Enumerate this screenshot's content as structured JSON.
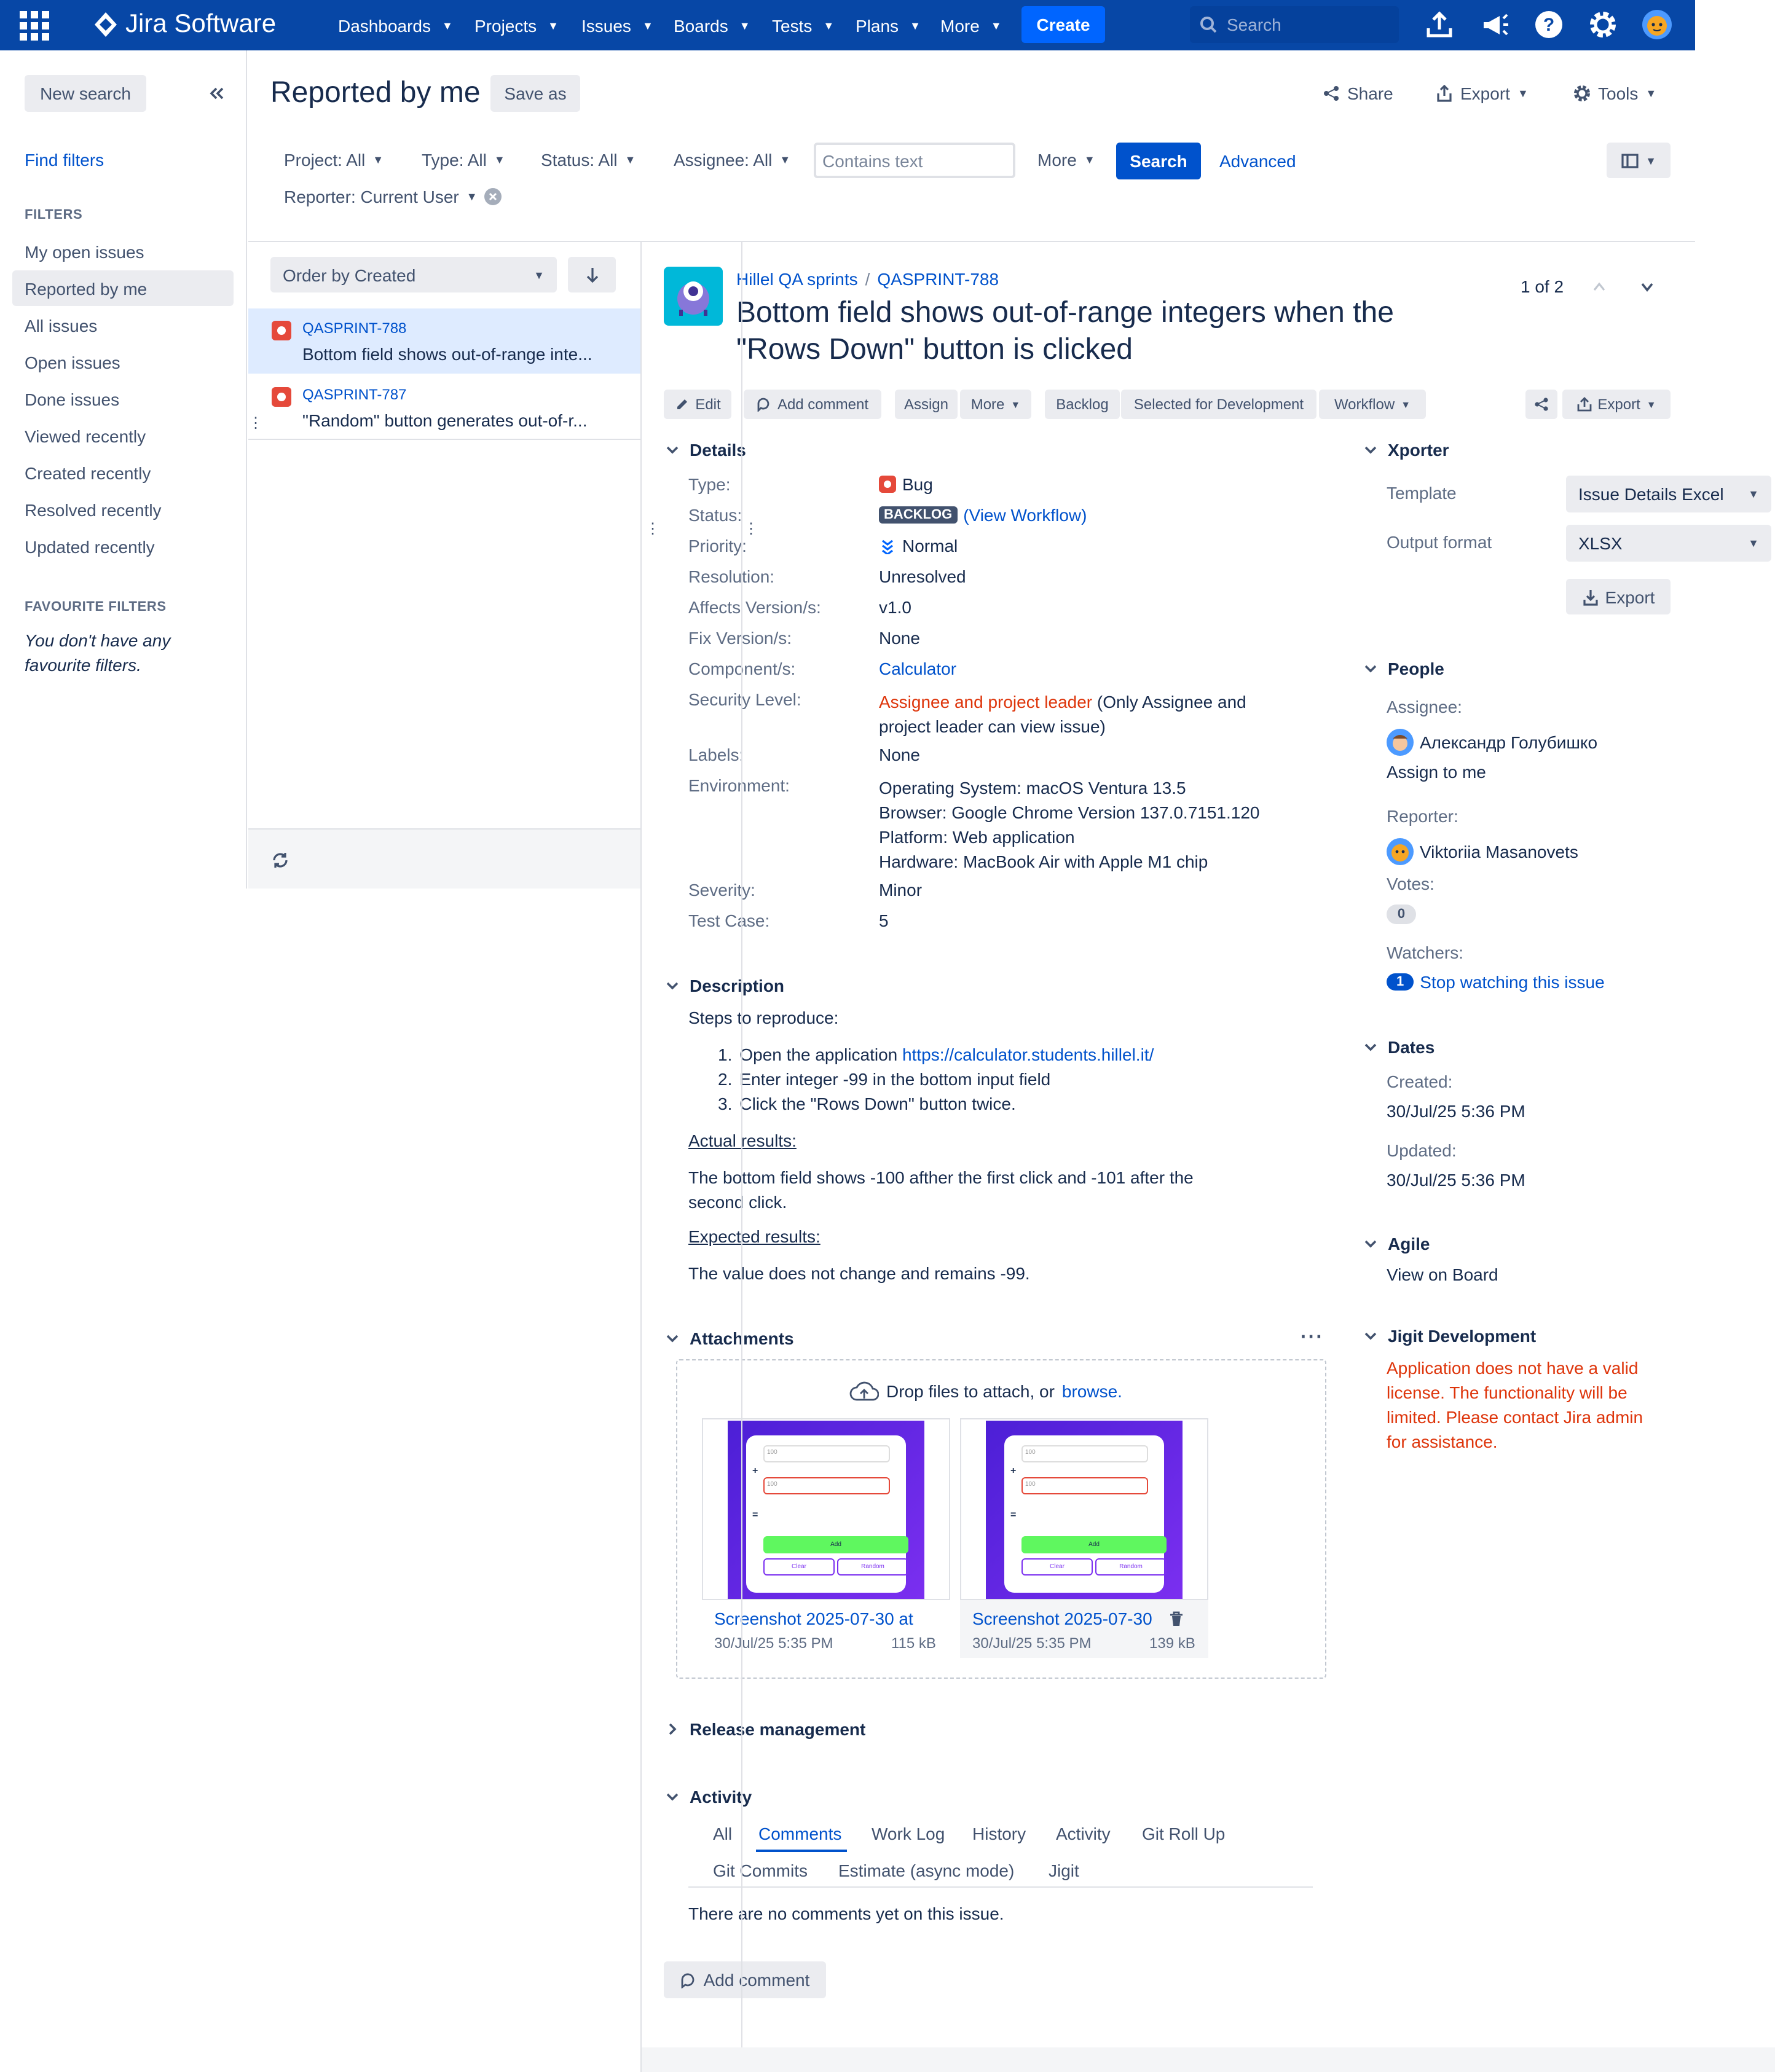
{
  "colors": {
    "nav": "#0747a6",
    "create": "#0065ff",
    "primary": "#0052cc",
    "selected_row": "#deebff",
    "bug": "#e5493a",
    "error": "#de350b"
  },
  "topnav": {
    "logo": "Jira Software",
    "items": [
      "Dashboards",
      "Projects",
      "Issues",
      "Boards",
      "Tests",
      "Plans",
      "More"
    ],
    "create": "Create",
    "search_placeholder": "Search",
    "icons": [
      "upload-icon",
      "megaphone-icon",
      "help-icon",
      "settings-icon",
      "user-avatar"
    ]
  },
  "sidebar": {
    "new_search": "New search",
    "find_filters": "Find filters",
    "filters_heading": "FILTERS",
    "filters": [
      "My open issues",
      "Reported by me",
      "All issues",
      "Open issues",
      "Done issues",
      "Viewed recently",
      "Created recently",
      "Resolved recently",
      "Updated recently"
    ],
    "selected": "Reported by me",
    "fav_heading": "FAVOURITE FILTERS",
    "fav_empty": "You don't have any favourite filters."
  },
  "header": {
    "title": "Reported by me",
    "save_as": "Save as",
    "share": "Share",
    "export": "Export",
    "tools": "Tools"
  },
  "search": {
    "project": "Project: All",
    "type": "Type: All",
    "status": "Status: All",
    "assignee": "Assignee: All",
    "text_placeholder": "Contains text",
    "more": "More",
    "search_btn": "Search",
    "advanced": "Advanced",
    "reporter": "Reporter: Current User"
  },
  "list": {
    "order": "Order by Created",
    "items": [
      {
        "key": "QASPRINT-788",
        "summary": "Bottom field shows out-of-range inte..."
      },
      {
        "key": "QASPRINT-787",
        "summary": "\"Random\" button generates out-of-r..."
      }
    ]
  },
  "issue": {
    "project": "Hillel QA sprints",
    "key": "QASPRINT-788",
    "counter": "1 of 2",
    "title_line1": "Bottom field shows out-of-range integers when the",
    "title_line2": "\"Rows Down\" button is clicked",
    "toolbar": {
      "edit": "Edit",
      "add_comment": "Add comment",
      "assign": "Assign",
      "more": "More",
      "backlog": "Backlog",
      "selected_for_dev": "Selected for Development",
      "workflow": "Workflow",
      "export": "Export"
    },
    "details_heading": "Details",
    "details": {
      "type_label": "Type:",
      "type": "Bug",
      "status_label": "Status:",
      "status": "BACKLOG",
      "view_workflow": "(View Workflow)",
      "priority_label": "Priority:",
      "priority": "Normal",
      "resolution_label": "Resolution:",
      "resolution": "Unresolved",
      "affects_label": "Affects Version/s:",
      "affects": "v1.0",
      "fix_label": "Fix Version/s:",
      "fix": "None",
      "component_label": "Component/s:",
      "component": "Calculator",
      "security_label": "Security Level:",
      "security_link": "Assignee and project leader",
      "security_rest1": " (Only Assignee and",
      "security_rest2": "project leader can view issue)",
      "labels_label": "Labels:",
      "labels": "None",
      "env_label": "Environment:",
      "env": [
        "Operating System: macOS Ventura 13.5",
        "Browser: Google Chrome Version 137.0.7151.120",
        "Platform: Web application",
        "Hardware: MacBook Air with Apple M1 chip"
      ],
      "severity_label": "Severity:",
      "severity": "Minor",
      "testcase_label": "Test Case:",
      "testcase": "5"
    },
    "description_heading": "Description",
    "description": {
      "steps_title": "Steps to reproduce:",
      "step1_prefix": "Open the application ",
      "step1_link": "https://calculator.students.hillel.it/",
      "step2": "Enter integer -99 in the bottom input field",
      "step3": "Click the \"Rows Down\" button twice.",
      "actual_title": "Actual results:",
      "actual1": "The bottom field shows -100 afther the first click and -101 after the",
      "actual2": "second click.",
      "expected_title": "Expected results:",
      "expected": "The value does not change and remains -99."
    },
    "attachments_heading": "Attachments",
    "drop_text": "Drop files to attach, or ",
    "browse": "browse.",
    "attachments": [
      {
        "name": "Screenshot 2025-07-30 at",
        "date": "30/Jul/25 5:35 PM",
        "size": "115 kB"
      },
      {
        "name": "Screenshot 2025-07-30",
        "date": "30/Jul/25 5:35 PM",
        "size": "139 kB"
      }
    ],
    "release_heading": "Release management",
    "activity_heading": "Activity",
    "activity_tabs": [
      "All",
      "Comments",
      "Work Log",
      "History",
      "Activity",
      "Git Roll Up",
      "Git Commits",
      "Estimate (async mode)",
      "Jigit"
    ],
    "active_tab": "Comments",
    "no_comments": "There are no comments yet on this issue.",
    "add_comment_btn": "Add comment"
  },
  "right": {
    "xporter_heading": "Xporter",
    "template_label": "Template",
    "template_value": "Issue Details Excel",
    "output_label": "Output format",
    "output_value": "XLSX",
    "export_btn": "Export",
    "people_heading": "People",
    "assignee_label": "Assignee:",
    "assignee": "Александр Голубишко",
    "assign_to_me": "Assign to me",
    "reporter_label": "Reporter:",
    "reporter": "Viktoriia Masanovets",
    "votes_label": "Votes:",
    "votes": "0",
    "watchers_label": "Watchers:",
    "watchers": "1",
    "stop_watching": "Stop watching this issue",
    "dates_heading": "Dates",
    "created_label": "Created:",
    "created": "30/Jul/25 5:36 PM",
    "updated_label": "Updated:",
    "updated": "30/Jul/25 5:36 PM",
    "agile_heading": "Agile",
    "view_board": "View on Board",
    "jigit_heading": "Jigit Development",
    "jigit_msg": [
      "Application does not have a valid",
      "license. The functionality will be",
      "limited. Please contact Jira admin",
      "for assistance."
    ]
  },
  "thumb_text": {
    "calc_hint": "100",
    "add": "Add",
    "clear": "Clear",
    "random": "Random"
  }
}
